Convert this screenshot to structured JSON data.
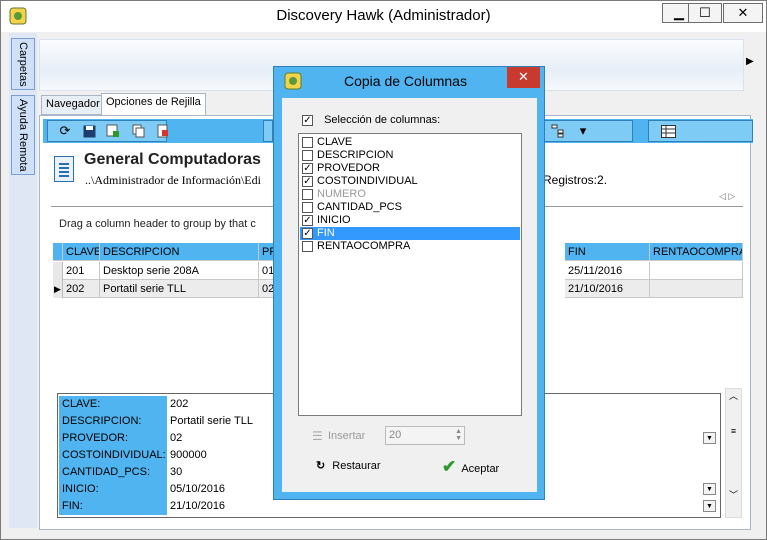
{
  "window": {
    "title": "Discovery Hawk (Administrador)",
    "minimize": "▁",
    "maximize": "☐",
    "close": "✕"
  },
  "sidebar": {
    "tabs": [
      {
        "label": "Carpetas"
      },
      {
        "label": "Ayuda Remota"
      }
    ]
  },
  "tabs": [
    {
      "label": "Navegador"
    },
    {
      "label": "Opciones de Rejilla"
    }
  ],
  "header": {
    "title": "General Computadoras",
    "path": "..\\Administrador de Información\\Edi",
    "registros": "Registros:2."
  },
  "group_hint": "Drag a column header to group by that c",
  "grid": {
    "columns": [
      "CLAVE",
      "DESCRIPCION",
      "PR",
      "FIN",
      "RENTAOCOMPRA"
    ],
    "rows": [
      {
        "clave": "201",
        "descripcion": "Desktop serie 208A",
        "pr": "01",
        "fin": "25/11/2016",
        "renta": ""
      },
      {
        "clave": "202",
        "descripcion": "Portatil serie TLL",
        "pr": "02",
        "fin": "21/10/2016",
        "renta": ""
      }
    ],
    "current_row_indicator": "▶"
  },
  "detail": [
    {
      "label": "CLAVE:",
      "value": "202"
    },
    {
      "label": "DESCRIPCION:",
      "value": "Portatil serie TLL"
    },
    {
      "label": "PROVEDOR:",
      "value": "02"
    },
    {
      "label": "COSTOINDIVIDUAL:",
      "value": "900000"
    },
    {
      "label": "CANTIDAD_PCS:",
      "value": "30"
    },
    {
      "label": "INICIO:",
      "value": "05/10/2016"
    },
    {
      "label": "FIN:",
      "value": "21/10/2016"
    }
  ],
  "dialog": {
    "title": "Copia de Columnas",
    "close": "✕",
    "select_all_label": "Selección de columnas:",
    "columns": [
      {
        "label": "CLAVE",
        "checked": false,
        "disabled": false,
        "selected": false
      },
      {
        "label": "DESCRIPCION",
        "checked": false,
        "disabled": false,
        "selected": false
      },
      {
        "label": "PROVEDOR",
        "checked": true,
        "disabled": false,
        "selected": false
      },
      {
        "label": "COSTOINDIVIDUAL",
        "checked": true,
        "disabled": false,
        "selected": false
      },
      {
        "label": "NUMERO",
        "checked": false,
        "disabled": true,
        "selected": false
      },
      {
        "label": "CANTIDAD_PCS",
        "checked": false,
        "disabled": false,
        "selected": false
      },
      {
        "label": "INICIO",
        "checked": true,
        "disabled": false,
        "selected": false
      },
      {
        "label": "FIN",
        "checked": true,
        "disabled": false,
        "selected": true
      },
      {
        "label": "RENTAOCOMPRA",
        "checked": false,
        "disabled": false,
        "selected": false
      }
    ],
    "insert_label": "Insertar",
    "insert_value": "20",
    "restore_label": "Restaurar",
    "accept_label": "Aceptar"
  },
  "colors": {
    "accent": "#4fb4f0",
    "selection": "#3399ff",
    "close": "#c8392e"
  }
}
